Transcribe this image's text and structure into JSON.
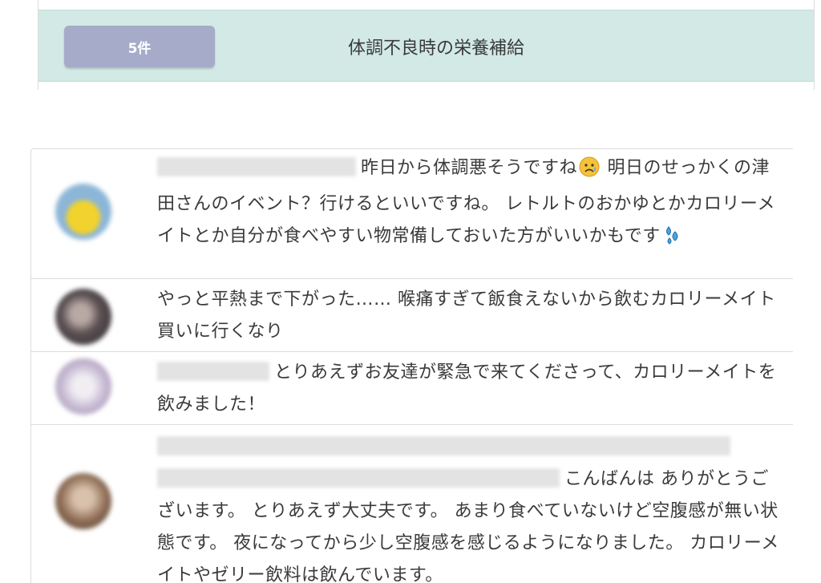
{
  "category": {
    "count_label": "5件",
    "title": "体調不良時の栄養補給",
    "row_color": "#d2e9e5",
    "badge_color": "#a6abc9"
  },
  "posts": [
    {
      "avatar_icon": "avatar-yellow-chick-icon",
      "mention_hidden": true,
      "text_part1": "昨日から体調悪そうですね",
      "emoji1": "sad-face-emoji",
      "text_part2": " 明日のせっかくの津田さんのイベント？行けるといいですね。 レトルトのおかゆとかカロリーメイトとか自分が食べやすい物常備しておいた方がいいかもです",
      "emoji2": "sweat-drops-emoji"
    },
    {
      "avatar_icon": "avatar-dark-photo-icon",
      "mention_hidden": false,
      "text": "やっと平熱まで下がった…… 喉痛すぎて飯食えないから飲むカロリーメイト買いに行くなり"
    },
    {
      "avatar_icon": "avatar-purple-illustration-icon",
      "mention_hidden": true,
      "text": "とりあえずお友達が緊急で来てくださって、カロリーメイトを飲みました！"
    },
    {
      "avatar_icon": "avatar-brown-photo-icon",
      "mention_hidden": true,
      "text": "こんばんは ありがとうございます。 とりあえず大丈夫です。 あまり食べていないけど空腹感が無い状態です。 夜になってから少し空腹感を感じるようになりました。 カロリーメイトやゼリー飲料は飲んでいます。"
    }
  ]
}
